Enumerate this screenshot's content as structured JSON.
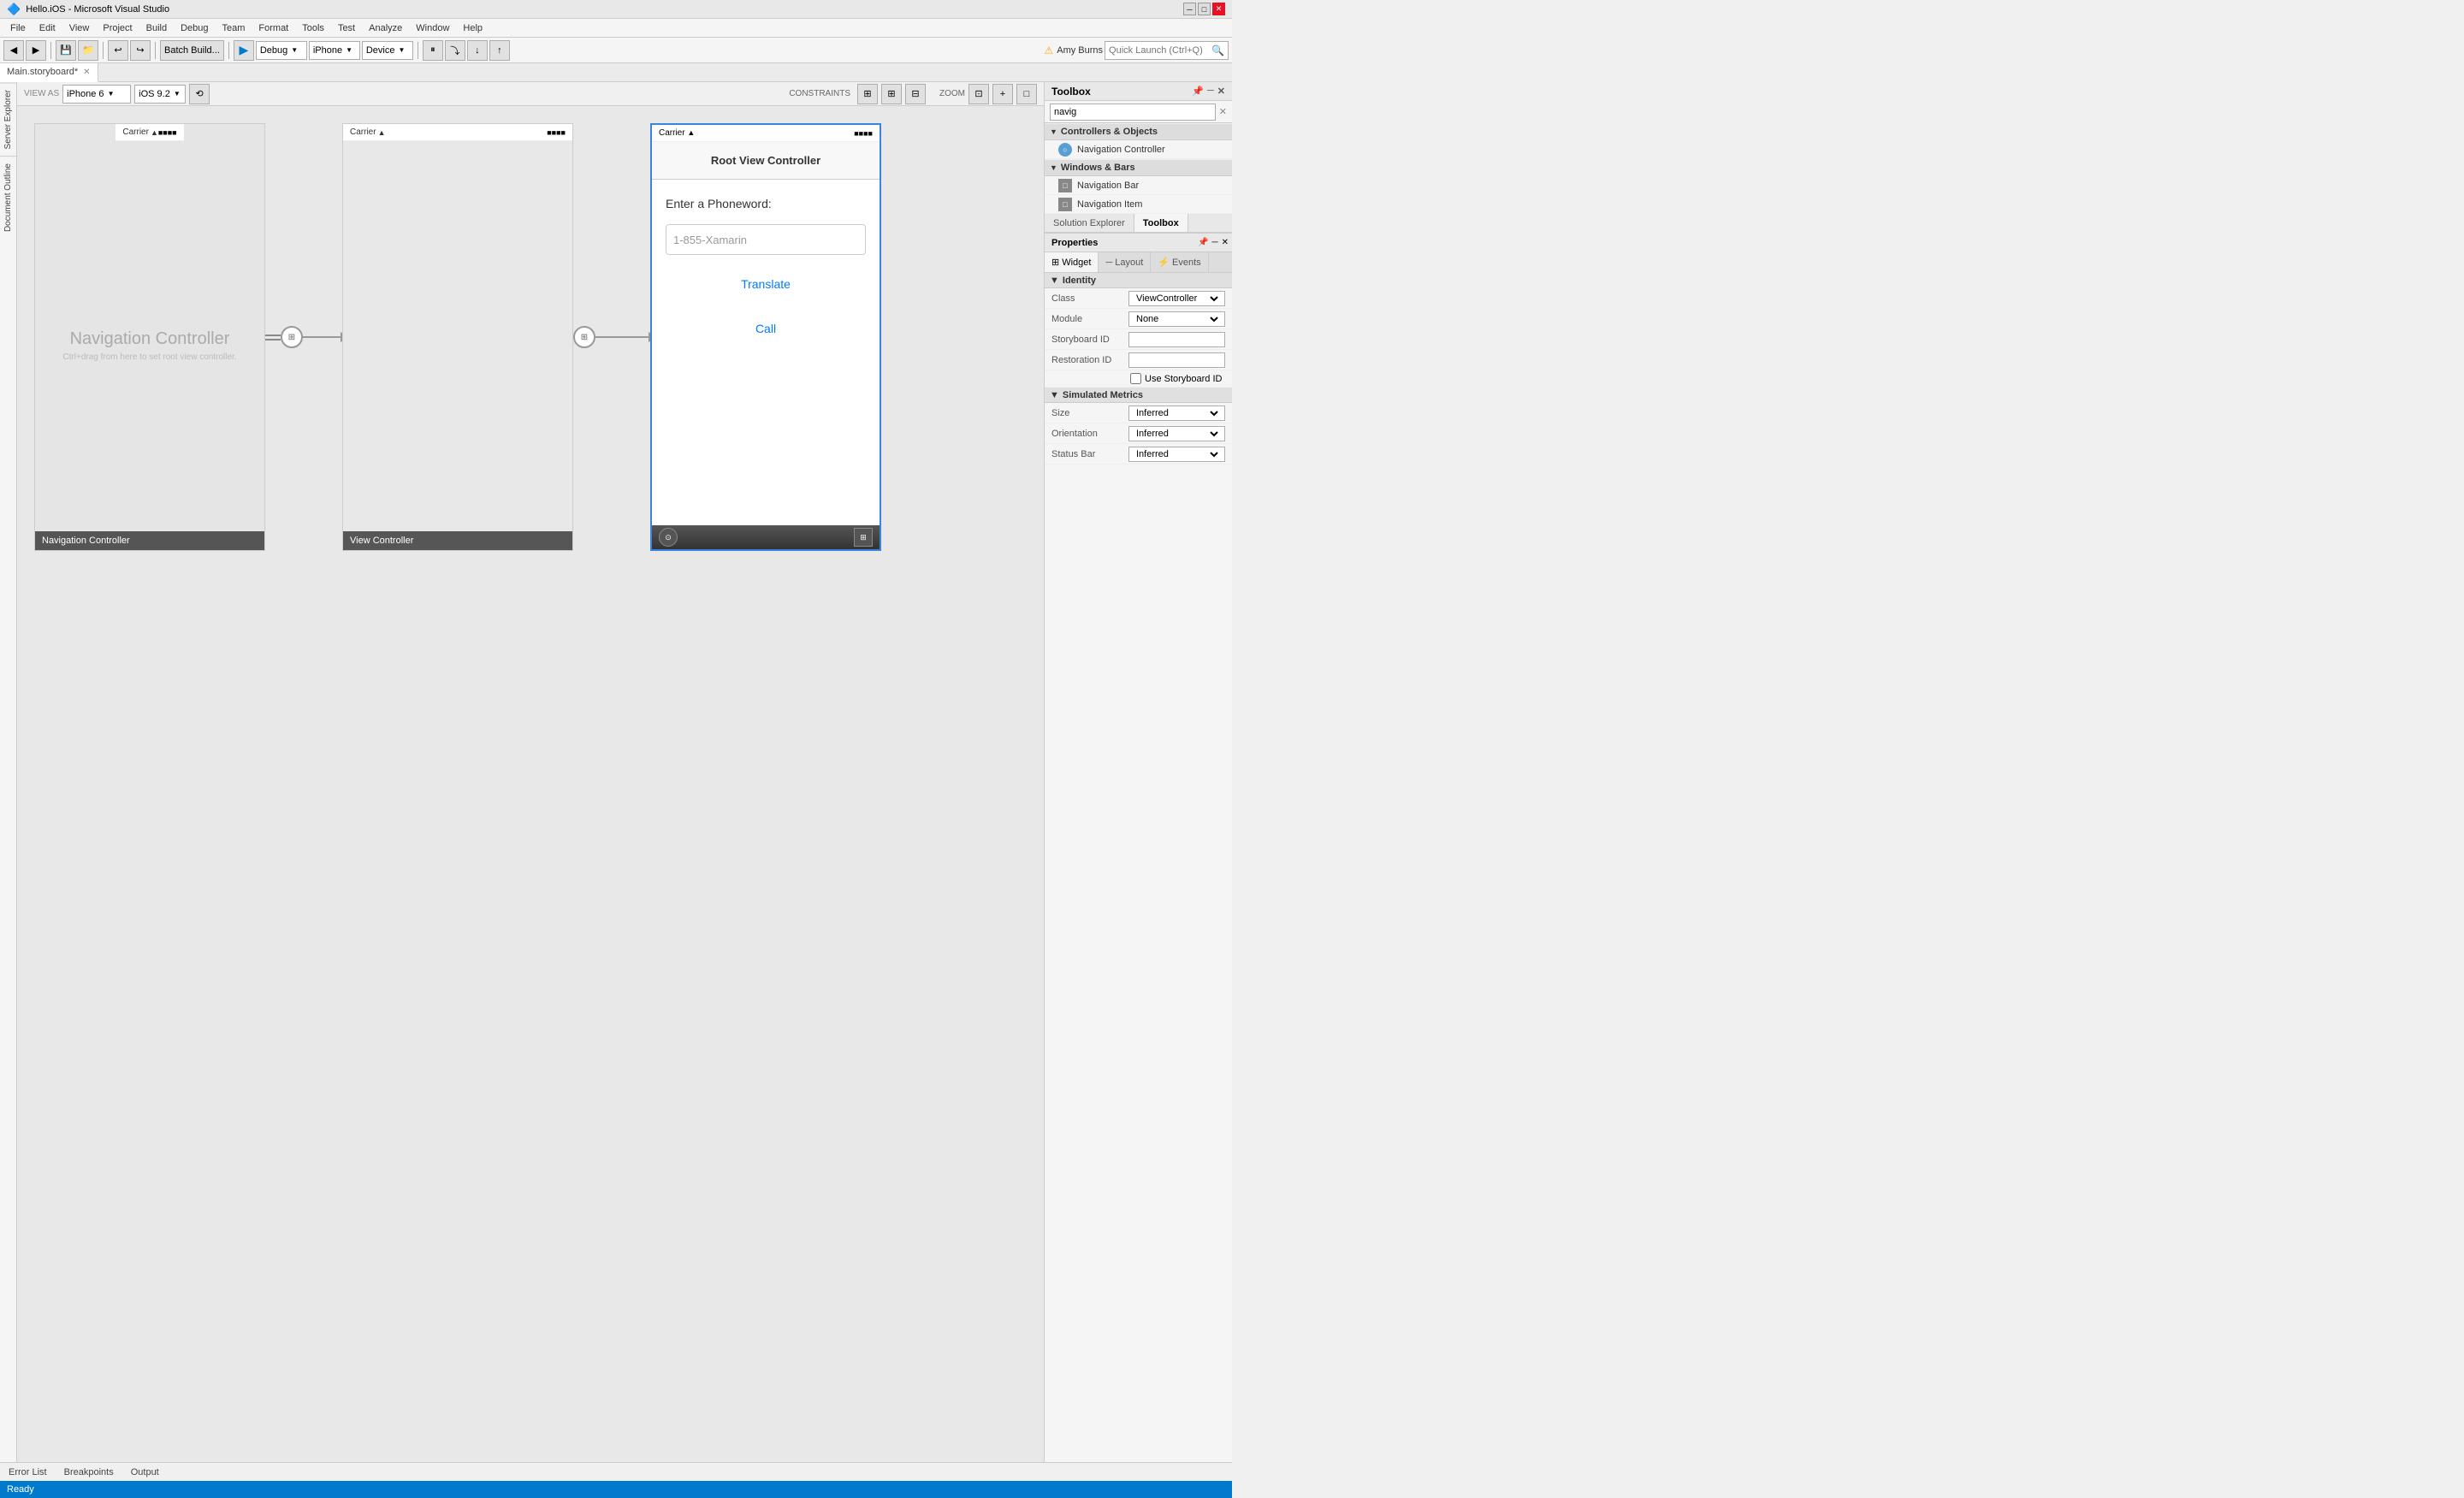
{
  "titlebar": {
    "title": "Hello.iOS - Microsoft Visual Studio",
    "icon": "vs-icon"
  },
  "menubar": {
    "items": [
      "File",
      "Edit",
      "View",
      "Project",
      "Build",
      "Debug",
      "Team",
      "Format",
      "Tools",
      "Test",
      "Analyze",
      "Window",
      "Help"
    ]
  },
  "toolbar": {
    "debug_dropdown": "Debug",
    "device_dropdown": "iPhone",
    "device_version_dropdown": "Device",
    "search_placeholder": "Quick Launch (Ctrl+Q)",
    "user_name": "Amy Burns",
    "batch_build": "Batch Build...",
    "run_icon": "▶"
  },
  "tab": {
    "name": "Main.storyboard*",
    "close": "✕"
  },
  "canvas_toolbar": {
    "view_as_label": "VIEW AS",
    "iphone_version": "iPhone 6",
    "ios_version": "iOS 9.2",
    "constraints_label": "CONSTRAINTS",
    "zoom_label": "ZOOM"
  },
  "scenes": {
    "nav_controller": {
      "title": "Navigation Controller",
      "subtitle": "Ctrl+drag from here to set root view controller.",
      "statusbar_carrier": "Carrier",
      "statusbar_battery": "■■■■",
      "footer_label": "Navigation Controller"
    },
    "view_controller": {
      "title": "View Controller",
      "statusbar_carrier": "Carrier",
      "statusbar_battery": "■■■■",
      "footer_label": "View Controller"
    },
    "root_vc": {
      "navbar_title": "Root View Controller",
      "statusbar_carrier": "Carrier",
      "statusbar_battery": "■■■■",
      "enter_phoneword_label": "Enter a Phoneword:",
      "input_placeholder": "1-855-Xamarin",
      "translate_btn": "Translate",
      "call_btn": "Call"
    }
  },
  "toolbox": {
    "title": "Toolbox",
    "search_placeholder": "navig",
    "sections": [
      {
        "name": "Controllers & Objects",
        "items": [
          {
            "label": "Navigation Controller",
            "icon": "○"
          }
        ]
      },
      {
        "name": "Windows & Bars",
        "items": [
          {
            "label": "Navigation Bar",
            "icon": "□"
          },
          {
            "label": "Navigation Item",
            "icon": "□"
          }
        ]
      }
    ]
  },
  "solution_explorer_tab": "Solution Explorer",
  "toolbox_tab": "Toolbox",
  "properties": {
    "title": "Properties",
    "tabs": [
      {
        "label": "Widget",
        "icon": "⊞",
        "active": true
      },
      {
        "label": "Layout",
        "icon": "—"
      },
      {
        "label": "Events",
        "icon": "⚡"
      }
    ],
    "sections": [
      {
        "name": "Identity",
        "rows": [
          {
            "label": "Class",
            "value": "ViewController",
            "type": "dropdown"
          },
          {
            "label": "Module",
            "value": "None",
            "type": "dropdown"
          },
          {
            "label": "Storyboard ID",
            "value": "",
            "type": "input"
          },
          {
            "label": "Restoration ID",
            "value": "",
            "type": "input"
          },
          {
            "label": "",
            "checkbox": true,
            "checkbox_label": "Use Storyboard ID",
            "type": "checkbox"
          }
        ]
      },
      {
        "name": "Simulated Metrics",
        "rows": [
          {
            "label": "Size",
            "value": "Inferred",
            "type": "dropdown"
          },
          {
            "label": "Orientation",
            "value": "Inferred",
            "type": "dropdown"
          },
          {
            "label": "Status Bar",
            "value": "Inferred",
            "type": "dropdown"
          }
        ]
      }
    ]
  },
  "status": {
    "text": "Ready"
  },
  "bottom_tabs": [
    "Error List",
    "Breakpoints",
    "Output"
  ],
  "sidebar_tabs": [
    "Server Explorer",
    "Document Outline"
  ]
}
